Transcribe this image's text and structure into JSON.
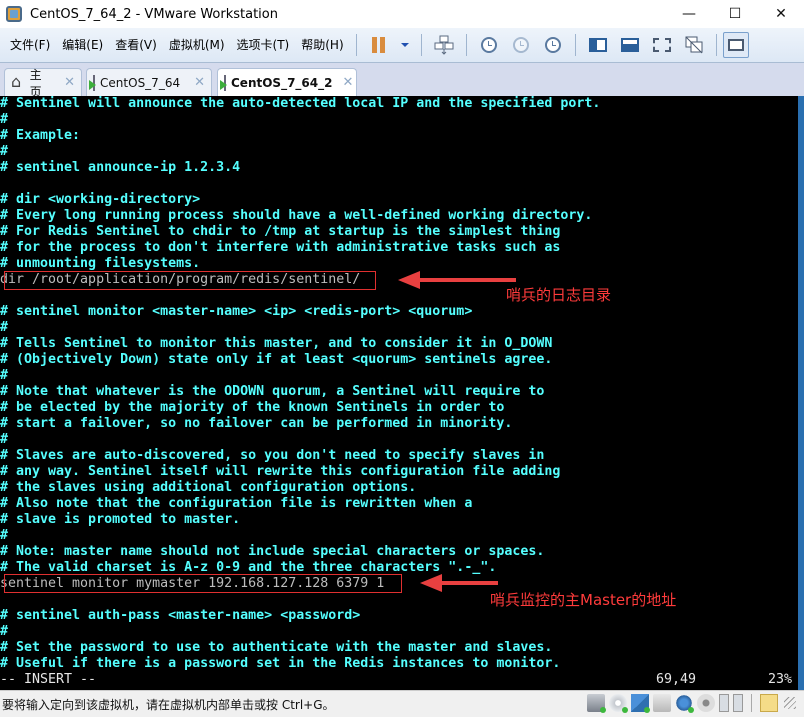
{
  "window": {
    "title": "CentOS_7_64_2 - VMware Workstation",
    "controls": {
      "minimize": "—",
      "maximize": "☐",
      "close": "✕"
    }
  },
  "menu": {
    "items": [
      {
        "label": "文件(F)"
      },
      {
        "label": "编辑(E)"
      },
      {
        "label": "查看(V)"
      },
      {
        "label": "虚拟机(M)"
      },
      {
        "label": "选项卡(T)"
      },
      {
        "label": "帮助(H)"
      }
    ],
    "toolbar_icons": [
      "pause-icon",
      "pause-dropdown-icon",
      "send-ctrl-alt-del-icon",
      "take-snapshot-icon",
      "revert-snapshot-icon",
      "snapshot-manager-icon",
      "show-library-icon",
      "show-thumbnail-bar-icon",
      "full-screen-icon",
      "unity-icon",
      "console-view-icon"
    ]
  },
  "tabs": [
    {
      "label": "主页",
      "icon": "home-icon",
      "close": "✕",
      "active": false
    },
    {
      "label": "CentOS_7_64",
      "icon": "vm-icon",
      "close": "✕",
      "active": false
    },
    {
      "label": "CentOS_7_64_2",
      "icon": "vm-icon",
      "close": "✕",
      "active": true
    }
  ],
  "terminal": {
    "lines": [
      "# Sentinel will announce the auto-detected local IP and the specified port.",
      "#",
      "# Example:",
      "#",
      "# sentinel announce-ip 1.2.3.4",
      "",
      "# dir <working-directory>",
      "# Every long running process should have a well-defined working directory.",
      "# For Redis Sentinel to chdir to /tmp at startup is the simplest thing",
      "# for the process to don't interfere with administrative tasks such as",
      "# unmounting filesystems.",
      "dir /root/application/program/redis/sentinel/",
      "",
      "# sentinel monitor <master-name> <ip> <redis-port> <quorum>",
      "#",
      "# Tells Sentinel to monitor this master, and to consider it in O_DOWN",
      "# (Objectively Down) state only if at least <quorum> sentinels agree.",
      "#",
      "# Note that whatever is the ODOWN quorum, a Sentinel will require to",
      "# be elected by the majority of the known Sentinels in order to",
      "# start a failover, so no failover can be performed in minority.",
      "#",
      "# Slaves are auto-discovered, so you don't need to specify slaves in",
      "# any way. Sentinel itself will rewrite this configuration file adding",
      "# the slaves using additional configuration options.",
      "# Also note that the configuration file is rewritten when a",
      "# slave is promoted to master.",
      "#",
      "# Note: master name should not include special characters or spaces.",
      "# The valid charset is A-z 0-9 and the three characters \".-_\".",
      "sentinel monitor mymaster 192.168.127.128 6379 1",
      "",
      "# sentinel auth-pass <master-name> <password>",
      "#",
      "# Set the password to use to authenticate with the master and slaves.",
      "# Useful if there is a password set in the Redis instances to monitor."
    ],
    "plain_lines": [
      11,
      30
    ],
    "mode": "-- INSERT --",
    "cursor_pos": "69,49",
    "scroll_percent": "23%"
  },
  "annotations": [
    {
      "text": "哨兵的日志目录",
      "target_line": 11
    },
    {
      "text": "哨兵监控的主Master的地址",
      "target_line": 30
    }
  ],
  "statusbar": {
    "message": "要将输入定向到该虚拟机，请在虚拟机内部单击或按 Ctrl+G。",
    "device_icons": [
      "hard-disk-icon",
      "cd-dvd-icon",
      "network-adapter-icon",
      "printer-icon",
      "sound-card-icon",
      "camera-icon",
      "usb-icon",
      "usb-icon",
      "message-log-icon"
    ]
  },
  "colors": {
    "terminal_text": "#55ffff",
    "terminal_bg": "#000000",
    "annotation_red": "#ff3b3b"
  }
}
